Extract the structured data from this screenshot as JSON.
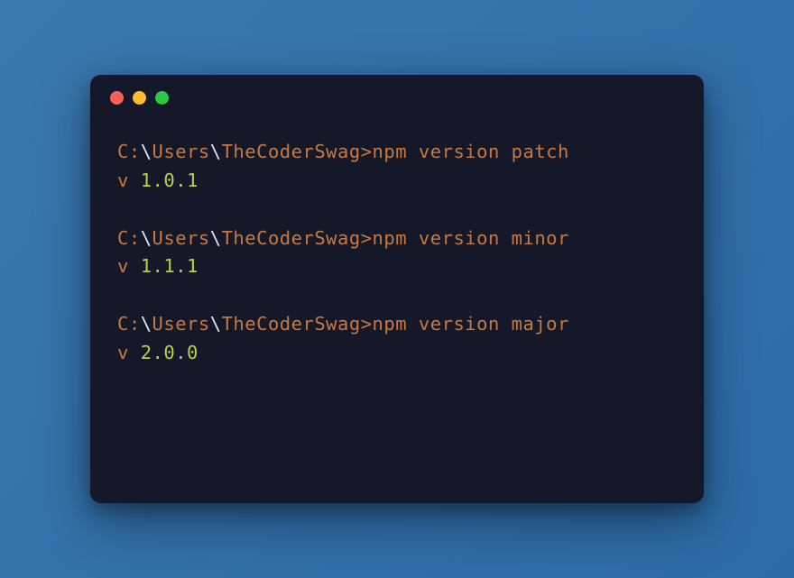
{
  "terminal": {
    "prompt": {
      "drive": "C:",
      "backslash": "\\",
      "seg1": "Users",
      "seg2": "TheCoderSwag",
      "gt": ">"
    },
    "commands": [
      {
        "cmd": "npm version patch",
        "output_prefix": "v ",
        "version": "1.0.1"
      },
      {
        "cmd": "npm version minor",
        "output_prefix": "v ",
        "version": "1.1.1"
      },
      {
        "cmd": "npm version major",
        "output_prefix": "v ",
        "version": "2.0.0"
      }
    ]
  }
}
